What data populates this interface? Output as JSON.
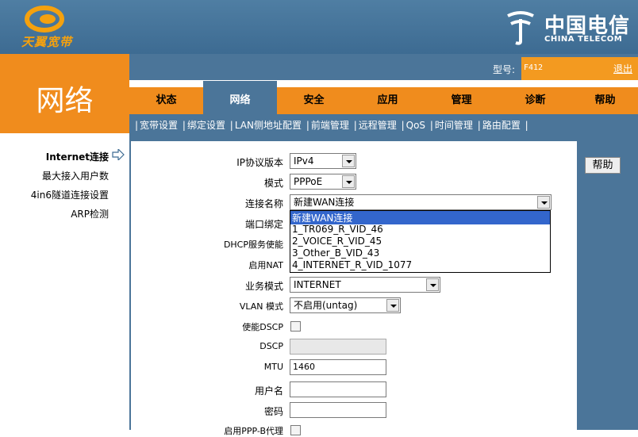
{
  "header": {
    "logo_text": "天翼宽带",
    "brand_cn": "中国电信",
    "brand_en": "CHINA TELECOM",
    "section_title": "网络",
    "model_label": "型号:",
    "model_value": "F412",
    "logout_label": "退出"
  },
  "nav": {
    "tabs": [
      {
        "label": "状态",
        "active": false
      },
      {
        "label": "网络",
        "active": true
      },
      {
        "label": "安全",
        "active": false
      },
      {
        "label": "应用",
        "active": false
      },
      {
        "label": "管理",
        "active": false
      },
      {
        "label": "诊断",
        "active": false
      },
      {
        "label": "帮助",
        "active": false
      }
    ],
    "sub_items": [
      "宽带设置",
      "绑定设置",
      "LAN侧地址配置",
      "前端管理",
      "远程管理",
      "QoS",
      "时间管理",
      "路由配置"
    ]
  },
  "sidebar": {
    "items": [
      {
        "label": "Internet连接",
        "active": true
      },
      {
        "label": "最大接入用户数",
        "active": false
      },
      {
        "label": "4in6隧道连接设置",
        "active": false
      },
      {
        "label": "ARP检测",
        "active": false
      }
    ]
  },
  "form": {
    "ip_version_label": "IP协议版本",
    "ip_version_value": "IPv4",
    "mode_label": "模式",
    "mode_value": "PPPoE",
    "conn_name_label": "连接名称",
    "conn_name_value": "新建WAN连接",
    "port_bind_label": "端口绑定",
    "dhcp_label": "DHCP服务使能",
    "nat_label": "启用NAT",
    "service_mode_label": "业务模式",
    "service_mode_value": "INTERNET",
    "vlan_mode_label": "VLAN 模式",
    "vlan_mode_value": "不启用(untag)",
    "dscp_enable_label": "使能DSCP",
    "dscp_label": "DSCP",
    "dscp_value": "",
    "mtu_label": "MTU",
    "mtu_value": "1460",
    "username_label": "用户名",
    "username_value": "",
    "password_label": "密码",
    "password_value": "",
    "ppp_proxy_label": "启用PPP-B代理"
  },
  "dropdown": {
    "options": [
      "新建WAN连接",
      "1_TR069_R_VID_46",
      "2_VOICE_R_VID_45",
      "3_Other_B_VID_43",
      "4_INTERNET_R_VID_1077"
    ],
    "selected_index": 0
  },
  "right_panel": {
    "help_label": "帮助"
  },
  "colors": {
    "orange": "#f08c1d",
    "blue": "#4b7599",
    "selection": "#3366cc"
  }
}
